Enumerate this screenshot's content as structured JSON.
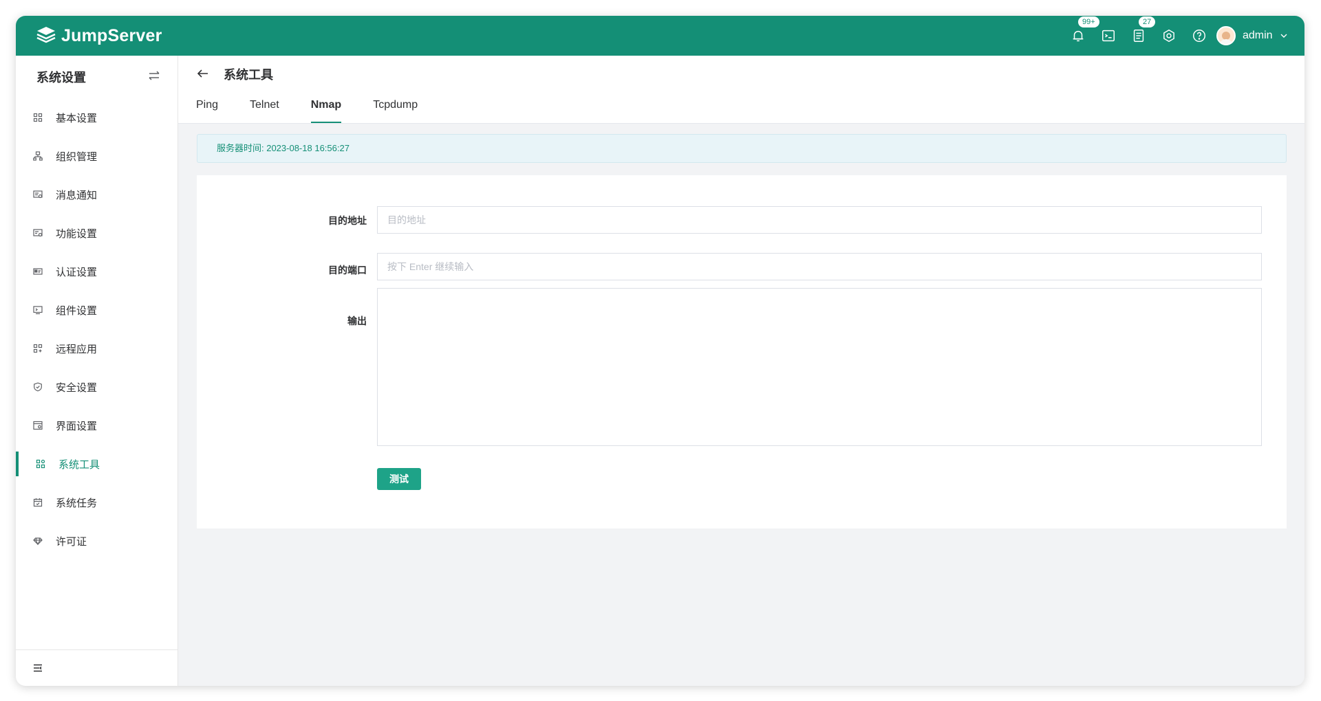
{
  "colors": {
    "brand": "#148f76",
    "button": "#1ea388",
    "info_bg": "#e8f4f8"
  },
  "header": {
    "logo_text": "JumpServer",
    "notification_badge": "99+",
    "tasks_badge": "27",
    "user": "admin",
    "icons": [
      "bell-icon",
      "terminal-icon",
      "task-list-icon",
      "settings-gear-icon",
      "help-icon"
    ]
  },
  "sidebar": {
    "title": "系统设置",
    "items": [
      {
        "label": "基本设置",
        "icon": "grid-icon"
      },
      {
        "label": "组织管理",
        "icon": "org-icon"
      },
      {
        "label": "消息通知",
        "icon": "message-icon"
      },
      {
        "label": "功能设置",
        "icon": "feature-icon"
      },
      {
        "label": "认证设置",
        "icon": "auth-card-icon"
      },
      {
        "label": "组件设置",
        "icon": "component-icon"
      },
      {
        "label": "远程应用",
        "icon": "remote-app-icon"
      },
      {
        "label": "安全设置",
        "icon": "shield-icon"
      },
      {
        "label": "界面设置",
        "icon": "interface-icon"
      },
      {
        "label": "系统工具",
        "icon": "tools-icon",
        "active": true
      },
      {
        "label": "系统任务",
        "icon": "calendar-icon"
      },
      {
        "label": "许可证",
        "icon": "license-icon"
      }
    ]
  },
  "main": {
    "title": "系统工具",
    "tabs": [
      {
        "label": "Ping"
      },
      {
        "label": "Telnet"
      },
      {
        "label": "Nmap",
        "active": true
      },
      {
        "label": "Tcpdump"
      }
    ],
    "server_time": "服务器时间: 2023-08-18 16:56:27",
    "form": {
      "target_label": "目的地址",
      "target_value": "",
      "target_placeholder": "目的地址",
      "port_label": "目的端口",
      "port_value": "",
      "port_placeholder": "按下 Enter 继续输入",
      "output_label": "输出",
      "output_value": "",
      "submit_label": "测试"
    }
  }
}
